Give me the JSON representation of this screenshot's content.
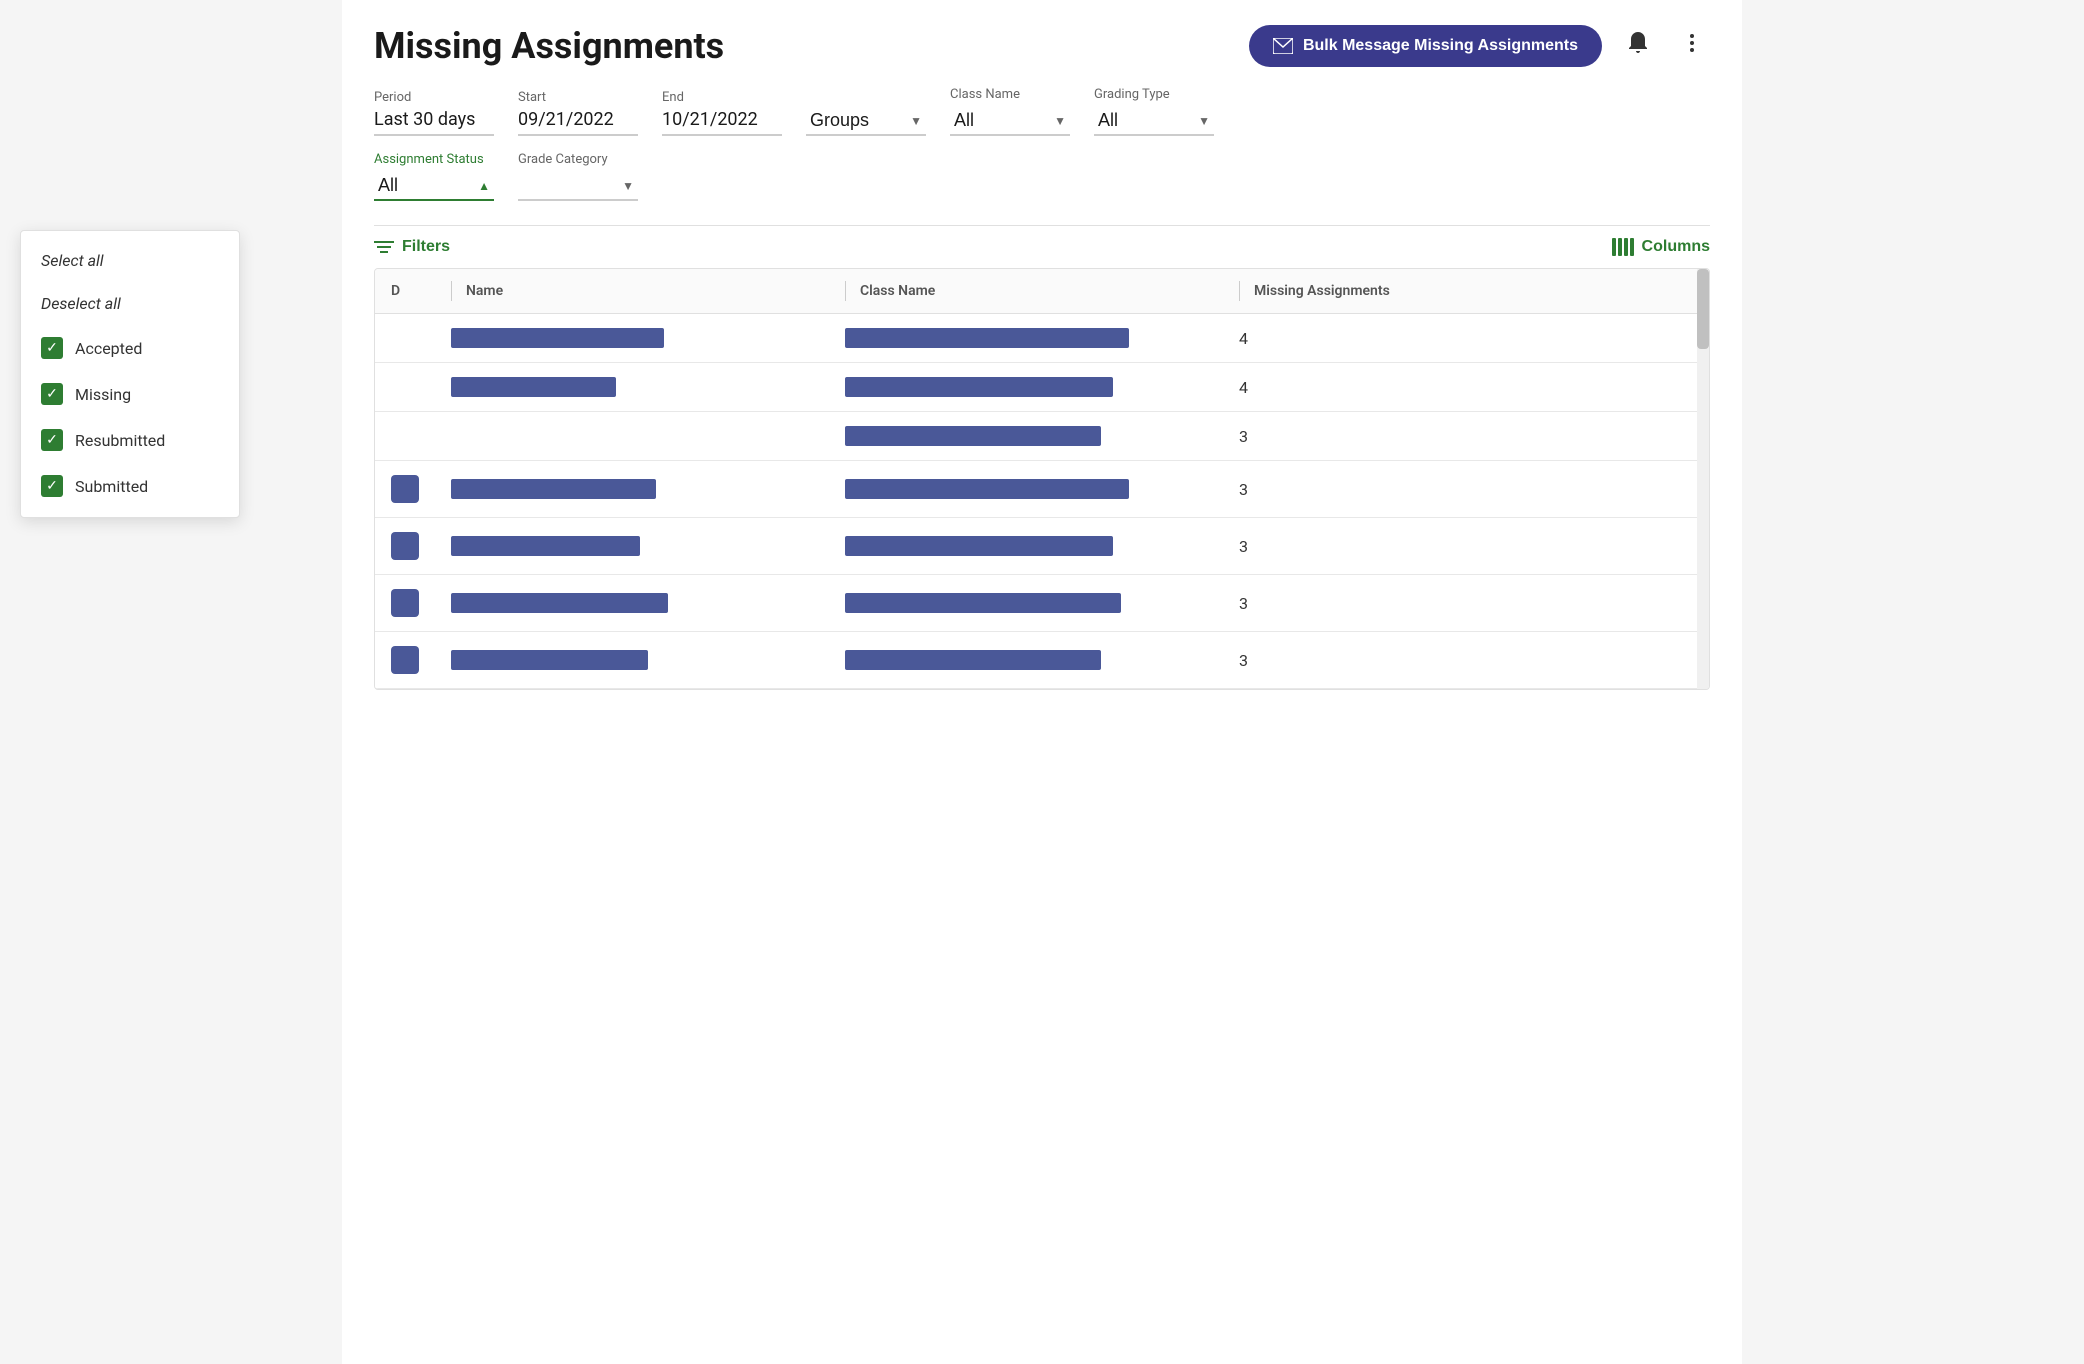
{
  "page": {
    "title": "Missing Assignments"
  },
  "header": {
    "bulk_message_btn": "Bulk Message Missing Assignments",
    "bell_icon": "bell",
    "more_options_icon": "more-vertical"
  },
  "filters": {
    "period_label": "Period",
    "period_value": "Last 30 days",
    "start_label": "Start",
    "start_value": "09/21/2022",
    "end_label": "End",
    "end_value": "10/21/2022",
    "groups_label": "",
    "groups_value": "Groups",
    "class_name_label": "Class Name",
    "class_name_value": "All",
    "grading_type_label": "Grading Type",
    "grading_type_value": "All",
    "assignment_status_label": "Assignment Status",
    "assignment_status_value": "All",
    "grade_category_label": "Grade Category",
    "grade_category_value": ""
  },
  "dropdown": {
    "select_all": "Select all",
    "deselect_all": "Deselect all",
    "items": [
      {
        "label": "Accepted",
        "checked": true
      },
      {
        "label": "Missing",
        "checked": true
      },
      {
        "label": "Resubmitted",
        "checked": true
      },
      {
        "label": "Submitted",
        "checked": true
      }
    ]
  },
  "toolbar": {
    "filters_btn": "Filters",
    "columns_btn": "Columns"
  },
  "table": {
    "columns": [
      {
        "label": "D",
        "id": "d"
      },
      {
        "label": "Name",
        "id": "name"
      },
      {
        "label": "Class Name",
        "id": "class_name"
      },
      {
        "label": "Missing Assignments",
        "id": "missing"
      }
    ],
    "rows": [
      {
        "count": "4",
        "name_width": "54%",
        "class_width": "72%"
      },
      {
        "count": "4",
        "name_width": "42%",
        "class_width": "68%"
      },
      {
        "count": "3",
        "name_width": "0%",
        "class_width": "65%"
      },
      {
        "count": "3",
        "name_width": "52%",
        "class_width": "72%"
      },
      {
        "count": "3",
        "name_width": "48%",
        "class_width": "68%"
      },
      {
        "count": "3",
        "name_width": "55%",
        "class_width": "70%"
      },
      {
        "count": "3",
        "name_width": "50%",
        "class_width": "65%"
      }
    ]
  },
  "colors": {
    "green_accent": "#2e7d32",
    "dark_blue_btn": "#3a3a8c",
    "bar_color": "#4a5898"
  }
}
